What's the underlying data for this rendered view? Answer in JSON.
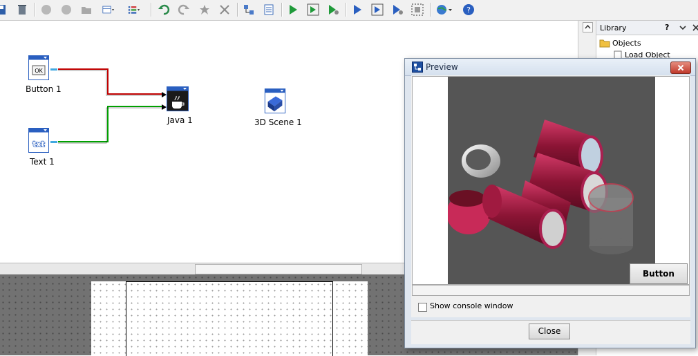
{
  "toolbar": {
    "icons": [
      "save-icon",
      "trash-icon",
      "circle-icon",
      "circle-icon",
      "folder-icon",
      "table-dropdown-icon",
      "list-dropdown-icon",
      "undo-icon",
      "redo-icon",
      "delete-icon",
      "close-icon",
      "connect-icon",
      "document-icon",
      "run-icon",
      "run-step-icon",
      "run-debug-icon",
      "play-icon",
      "play-step-icon",
      "play-debug-icon",
      "grid-icon",
      "globe-dropdown-icon",
      "help-icon"
    ]
  },
  "canvas": {
    "nodes": [
      {
        "name": "button-1",
        "label": "Button 1",
        "icon_text": "OK"
      },
      {
        "name": "text-1",
        "label": "Text 1",
        "icon_text": "txt"
      },
      {
        "name": "java-1",
        "label": "Java 1"
      },
      {
        "name": "scene-1",
        "label": "3D Scene 1"
      }
    ],
    "connections": [
      {
        "from": "Button 1",
        "to": "Java 1",
        "color": "#c00000"
      },
      {
        "from": "Text 1",
        "to": "Java 1",
        "color": "#00a000"
      }
    ]
  },
  "library": {
    "title": "Library",
    "help": "?",
    "items": [
      {
        "label": "Objects",
        "icon": "folder-icon"
      },
      {
        "label": "Load Object",
        "icon": "document-icon"
      }
    ]
  },
  "preview": {
    "title": "Preview",
    "button_label": "Button",
    "console_label": "Show console window",
    "console_checked": false,
    "close_label": "Close",
    "scene_bg": "#555555",
    "accent": "#b0204a"
  }
}
